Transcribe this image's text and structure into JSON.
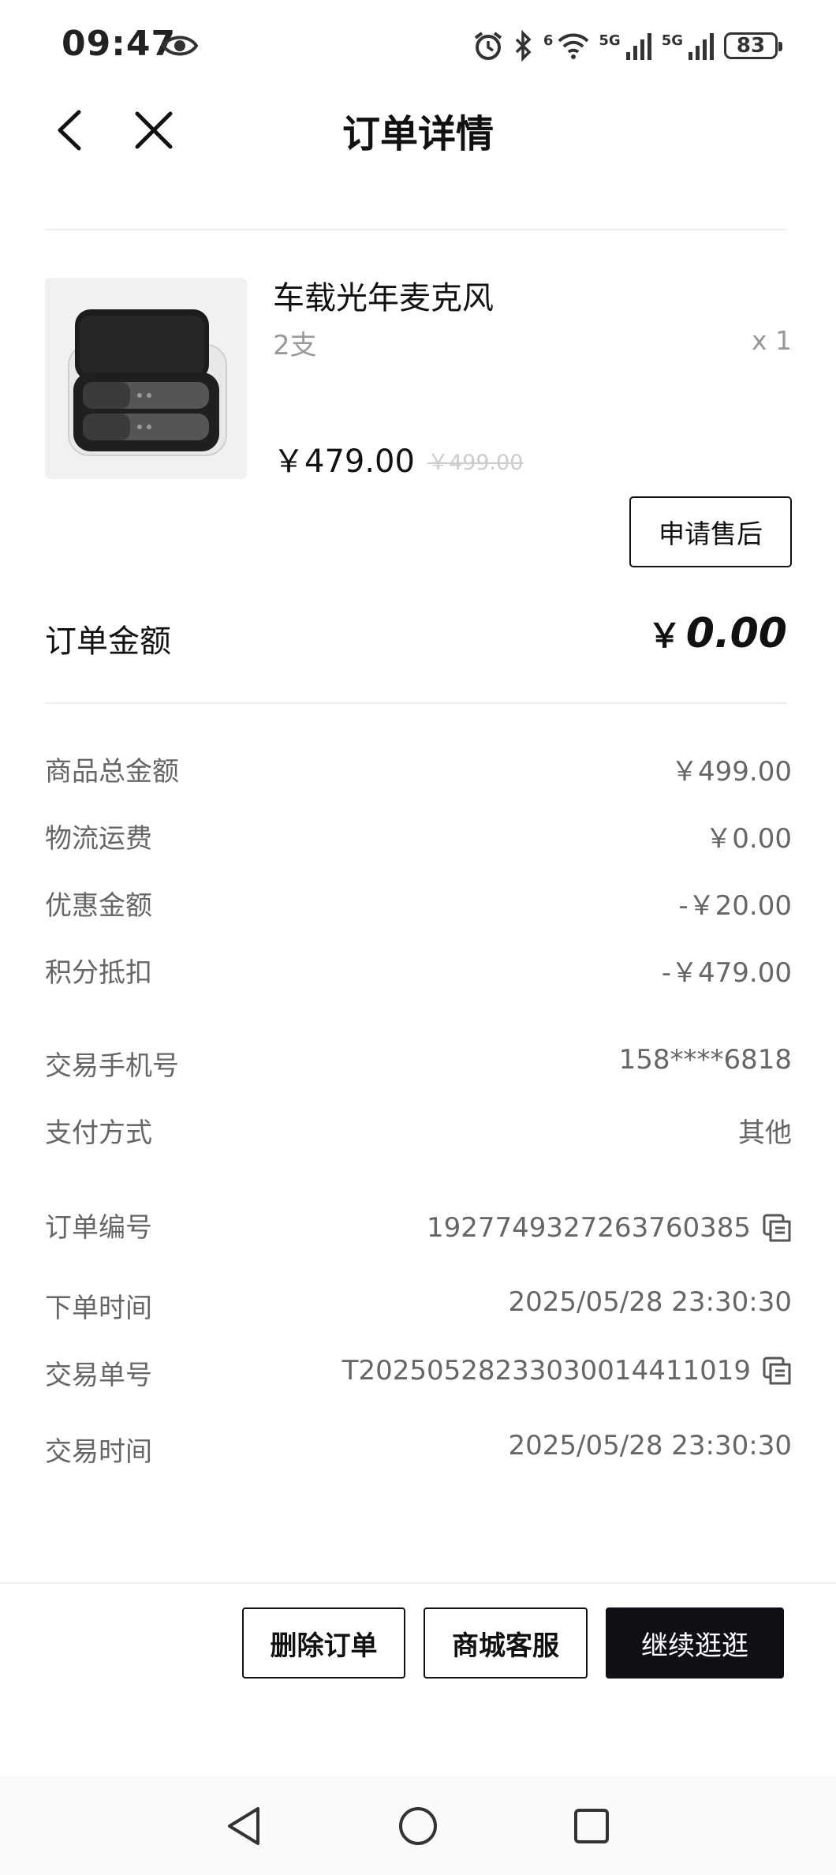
{
  "status_bar": {
    "time": "09:47",
    "battery": "83",
    "network_1": "5G",
    "network_2": "5G",
    "wifi_superscript": "6",
    "icons": [
      "eye-icon",
      "alarm-icon",
      "bluetooth-icon",
      "wifi-icon",
      "signal-icon",
      "signal-icon",
      "battery-icon"
    ]
  },
  "header": {
    "title": "订单详情",
    "back_icon": "chevron-left-icon",
    "close_icon": "close-icon"
  },
  "product": {
    "name": "车载光年麦克风",
    "spec": "2支",
    "quantity": "x 1",
    "price": "￥479.00",
    "original_price": "￥499.00",
    "after_sale_label": "申请售后"
  },
  "order_amount": {
    "label": "订单金额",
    "currency": "￥",
    "value": "0.00"
  },
  "price_details": [
    {
      "label": "商品总金额",
      "value": "￥499.00"
    },
    {
      "label": "物流运费",
      "value": "￥0.00"
    },
    {
      "label": "优惠金额",
      "value": "-￥20.00"
    },
    {
      "label": "积分抵扣",
      "value": "-￥479.00"
    }
  ],
  "payment_info": [
    {
      "label": "交易手机号",
      "value": "158****6818"
    },
    {
      "label": "支付方式",
      "value": "其他"
    }
  ],
  "order_info": [
    {
      "label": "订单编号",
      "value": "1927749327263760385",
      "copyable": true
    },
    {
      "label": "下单时间",
      "value": "2025/05/28 23:30:30",
      "copyable": false
    },
    {
      "label": "交易单号",
      "value": "T2025052823303001441101​9",
      "copyable": true
    },
    {
      "label": "交易时间",
      "value": "2025/05/28 23:30:30",
      "copyable": false
    }
  ],
  "footer": {
    "delete_label": "删除订单",
    "service_label": "商城客服",
    "continue_label": "继续逛逛"
  },
  "nav_bar": {
    "icons": [
      "back-triangle-icon",
      "home-circle-icon",
      "recents-square-icon"
    ]
  },
  "colors": {
    "primary_dark": "#0f1016",
    "text_secondary": "#666666",
    "text_muted": "#999999"
  }
}
